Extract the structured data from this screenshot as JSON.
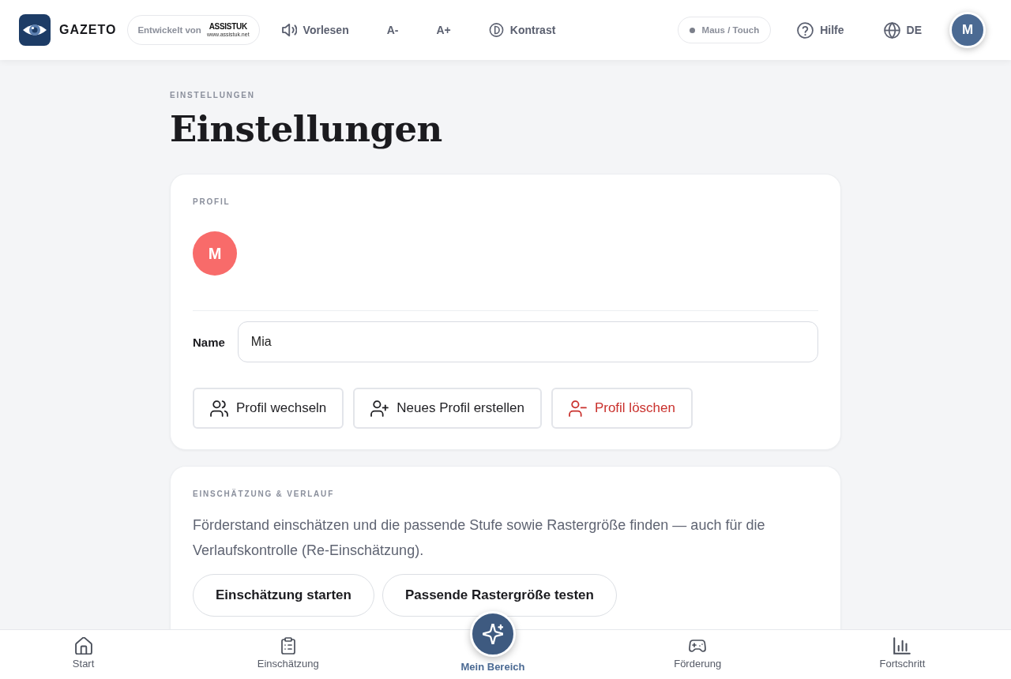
{
  "header": {
    "logo": {
      "name": "GAZETO"
    },
    "developer_badge": {
      "label": "Entwickelt von",
      "logo_text": "ASSISTUK",
      "logo_url": "www.assistuk.net"
    },
    "tools": [
      {
        "kind": "speaker",
        "label": "Vorlesen"
      },
      {
        "kind": "text",
        "label": "A-"
      },
      {
        "kind": "text",
        "label": "A+"
      },
      {
        "kind": "contrast",
        "label": "Kontrast"
      }
    ],
    "input_mode": {
      "label": "Maus / Touch"
    },
    "help": {
      "label": "Hilfe"
    },
    "language": {
      "label": "DE"
    },
    "avatar": {
      "initial": "M"
    }
  },
  "page": {
    "eyebrow": "EINSTELLUNGEN",
    "title": "Einstellungen"
  },
  "profile_card": {
    "heading": "PROFIL",
    "avatar": {
      "initial": "M"
    },
    "name_field": {
      "label": "Name",
      "value": "Mia"
    },
    "buttons": [
      {
        "kind": "switch",
        "label": "Profil wechseln"
      },
      {
        "kind": "add",
        "label": "Neues Profil erstellen"
      },
      {
        "kind": "delete",
        "label": "Profil löschen"
      }
    ]
  },
  "assessment_card": {
    "heading": "EINSCHÄTZUNG & VERLAUF",
    "text": "Förderstand einschätzen und die passende Stufe sowie Rastergröße finden — auch für die Verlaufskontrolle (Re-Einschätzung).",
    "buttons": [
      "Einschätzung starten",
      "Passende Rastergröße testen"
    ]
  },
  "bottom_nav": [
    {
      "kind": "home",
      "label": "Start",
      "selected": false
    },
    {
      "kind": "clipboard",
      "label": "Einschätzung",
      "selected": false
    },
    {
      "kind": "sparkle",
      "label": "Mein Bereich",
      "selected": true
    },
    {
      "kind": "gamepad",
      "label": "Förderung",
      "selected": false
    },
    {
      "kind": "chart",
      "label": "Fortschritt",
      "selected": false
    }
  ]
}
